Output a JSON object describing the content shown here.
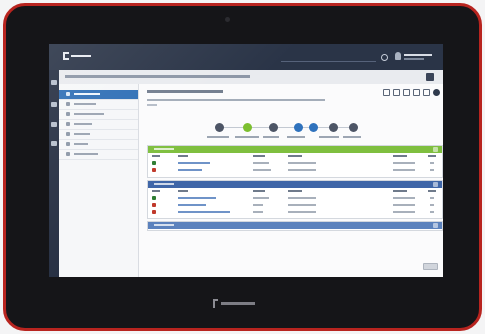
{
  "colors": {
    "frame_red": "#b8241f",
    "bezel": "#151518",
    "topbar": "#2a3447",
    "sidebar_active": "#2f6fb6",
    "panel_green": "#7fbf3f",
    "panel_blue": "#3f66a8",
    "panel_blue_light": "#5c82bd",
    "step_green": "#7cbf2f",
    "step_blue": "#2f72bd",
    "step_dark": "#4d5566"
  },
  "header": {
    "logo": "",
    "search_placeholder": "",
    "user_name": "",
    "user_role": ""
  },
  "breadcrumb": {
    "text": ""
  },
  "sidebar": {
    "items": [
      {
        "label": "",
        "icon": "dashboard-icon"
      },
      {
        "label": "",
        "icon": "document-icon"
      },
      {
        "label": "",
        "icon": "checklist-icon"
      },
      {
        "label": "",
        "icon": "document-icon"
      },
      {
        "label": "",
        "icon": "history-icon"
      },
      {
        "label": "",
        "icon": "link-icon"
      },
      {
        "label": "",
        "icon": "folder-icon"
      }
    ]
  },
  "main": {
    "title": "",
    "meta": "",
    "meta_sub": ""
  },
  "toolbar": {
    "icons": [
      "refresh-icon",
      "copy-icon",
      "print-icon",
      "export-icon",
      "edit-icon",
      "settings-icon"
    ]
  },
  "workflow": {
    "steps": [
      {
        "label": "",
        "state": "done"
      },
      {
        "label": "",
        "state": "current"
      },
      {
        "label": "",
        "state": "pending"
      },
      {
        "label": "",
        "state": "pending"
      },
      {
        "label": "",
        "state": "pending"
      },
      {
        "label": "",
        "state": "pending"
      },
      {
        "label": "",
        "state": "pending"
      }
    ]
  },
  "panels": [
    {
      "title": "",
      "color": "green",
      "columns": [
        "",
        "",
        "",
        "",
        "",
        ""
      ],
      "rows": [
        {
          "cells": [
            "",
            "",
            "",
            "",
            "",
            ""
          ],
          "icon": "document-icon"
        },
        {
          "cells": [
            "",
            "",
            "",
            "",
            "",
            ""
          ],
          "icon": "document-icon"
        }
      ]
    },
    {
      "title": "",
      "color": "blue",
      "columns": [
        "",
        "",
        "",
        "",
        "",
        ""
      ],
      "rows": [
        {
          "cells": [
            "",
            "",
            "",
            "",
            "",
            ""
          ],
          "icon": "document-icon"
        },
        {
          "cells": [
            "",
            "",
            "",
            "",
            "",
            ""
          ],
          "icon": "document-icon"
        },
        {
          "cells": [
            "",
            "",
            "",
            "",
            "",
            ""
          ],
          "icon": "document-icon"
        }
      ]
    },
    {
      "title": "",
      "color": "blue_light",
      "columns": [],
      "rows": []
    }
  ],
  "footer": {
    "button_label": ""
  },
  "device": {
    "brand": ""
  }
}
